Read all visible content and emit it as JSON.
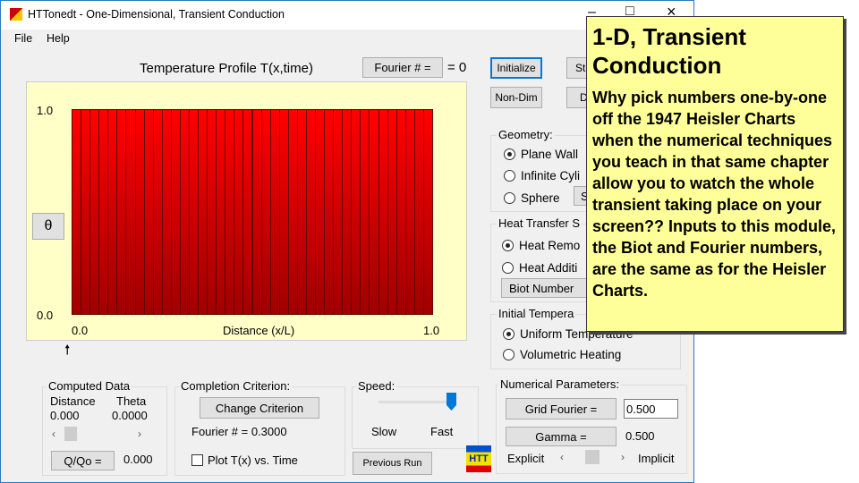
{
  "window": {
    "title": "HTTonedt - One-Dimensional, Transient Conduction",
    "minimize": "–",
    "maximize": "□",
    "close": "×"
  },
  "menu": [
    "File",
    "Help"
  ],
  "chart": {
    "title": "Temperature Profile T(x,time)",
    "fourier_button": "Fourier # =",
    "fourier_value": "= 0",
    "y_button": "θ",
    "ytick_top": "1.0",
    "ytick_bottom": "0.0",
    "xtick_left": "0.0",
    "xtick_right": "1.0",
    "xlabel": "Distance (x/L)",
    "marker": "🠕"
  },
  "chart_data": {
    "type": "bar",
    "xlabel": "Distance (x/L)",
    "ylabel": "θ",
    "xlim": [
      0,
      1
    ],
    "ylim": [
      0,
      1
    ],
    "values": [
      1,
      1,
      1,
      1,
      1,
      1,
      1,
      1,
      1,
      1,
      1,
      1,
      1,
      1,
      1,
      1,
      1,
      1,
      1,
      1,
      1,
      1,
      1,
      1,
      1,
      1,
      1,
      1,
      1,
      1,
      1,
      1,
      1,
      1,
      1,
      1,
      1,
      1,
      1,
      1
    ]
  },
  "buttons": {
    "initialize": "Initialize",
    "start": "Sta",
    "non_dim": "Non-Dim",
    "d": "D"
  },
  "geometry": {
    "label": "Geometry:",
    "options": [
      "Plane Wall",
      "Infinite Cyli",
      "Sphere"
    ],
    "extra_button": "S"
  },
  "heat_transfer": {
    "label": "Heat Transfer S",
    "options": [
      "Heat Remo",
      "Heat Additi"
    ],
    "biot_button": "Biot Number"
  },
  "initial": {
    "label": "Initial Tempera",
    "options": [
      "Uniform Temperature",
      "Volumetric Heating"
    ]
  },
  "computed": {
    "label": "Computed Data",
    "distance_label": "Distance",
    "theta_label": "Theta",
    "distance": "0.000",
    "theta": "0.0000",
    "q_button": "Q/Qo =",
    "q_value": "0.000"
  },
  "completion": {
    "label": "Completion Criterion:",
    "button": "Change Criterion",
    "fourier": "Fourier # = 0.3000",
    "plot_checkbox": "Plot T(x) vs. Time"
  },
  "speed": {
    "label": "Speed:",
    "slow": "Slow",
    "fast": "Fast",
    "value": 1.0
  },
  "previous_run": "Previous Run",
  "logo": "HTT",
  "numerical": {
    "label": "Numerical Parameters:",
    "grid_button": "Grid Fourier =",
    "grid_value": "0.500",
    "gamma_button": "Gamma =",
    "gamma_value": "0.500",
    "explicit": "Explicit",
    "implicit": "Implicit",
    "gamma_fraction": 0.5
  },
  "callout": {
    "title": "1-D, Transient Conduction",
    "body": "Why pick numbers one-by-one off the 1947 Heisler Charts when the numerical techniques you teach in that same chapter allow you to watch the whole transient taking place on your screen?? Inputs to this module, the Biot and Fourier numbers, are the same as for the Heisler Charts."
  }
}
